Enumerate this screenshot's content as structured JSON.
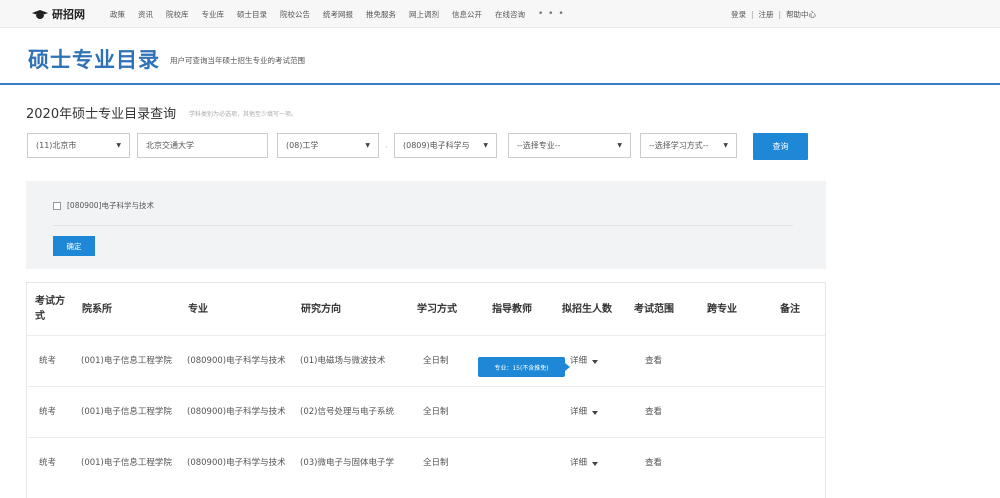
{
  "topnav": {
    "logo_text": "研招网",
    "items": [
      "政策",
      "资讯",
      "院校库",
      "专业库",
      "硕士目录",
      "院校公告",
      "统考网报",
      "推免服务",
      "网上调剂",
      "信息公开",
      "在线咨询"
    ],
    "more": "• • •",
    "login": "登录",
    "register": "注册",
    "help": "帮助中心",
    "separator": "|"
  },
  "header": {
    "title": "硕士专业目录",
    "subtitle": "用户可查询当年硕士招生专业的考试范围"
  },
  "query": {
    "title": "2020年硕士专业目录查询",
    "hint": "学科类别为必选项，其他至少填写一项。",
    "province": "(11)北京市",
    "school": "北京交通大学",
    "category": "(08)工学",
    "dot": "·",
    "discipline": "(0809)电子科学与",
    "major": "--选择专业--",
    "study_mode": "--选择学习方式--",
    "search_button": "查询"
  },
  "panel": {
    "checkbox_label": "[080900]电子科学与技术",
    "confirm_button": "确定"
  },
  "table": {
    "headers": [
      "考试方\n式",
      "院系所",
      "专业",
      "研究方向",
      "学习方式",
      "指导教师",
      "拟招生人数",
      "考试范围",
      "跨专业",
      "备注"
    ],
    "rows": [
      {
        "exam": "统考",
        "dept": "(001)电子信息工程学院",
        "major": "(080900)电子科学与技术",
        "direction": "(01)电磁场与微波技术",
        "mode": "全日制",
        "advisor": "",
        "quota": "详细",
        "scope": "查看",
        "cross": "",
        "note": ""
      },
      {
        "exam": "统考",
        "dept": "(001)电子信息工程学院",
        "major": "(080900)电子科学与技术",
        "direction": "(02)信号处理与电子系统",
        "mode": "全日制",
        "advisor": "",
        "quota": "详细",
        "scope": "查看",
        "cross": "",
        "note": ""
      },
      {
        "exam": "统考",
        "dept": "(001)电子信息工程学院",
        "major": "(080900)电子科学与技术",
        "direction": "(03)微电子与固体电子学",
        "mode": "全日制",
        "advisor": "",
        "quota": "详细",
        "scope": "查看",
        "cross": "",
        "note": ""
      }
    ],
    "tooltip": "专业：15(不含推免)"
  },
  "icons": {
    "logo": "graduation-cap-icon",
    "caret": "caret-down-icon"
  },
  "colors": {
    "accent": "#1e88d7",
    "title": "#2f72b7",
    "panel_bg": "#f1f3f5"
  }
}
